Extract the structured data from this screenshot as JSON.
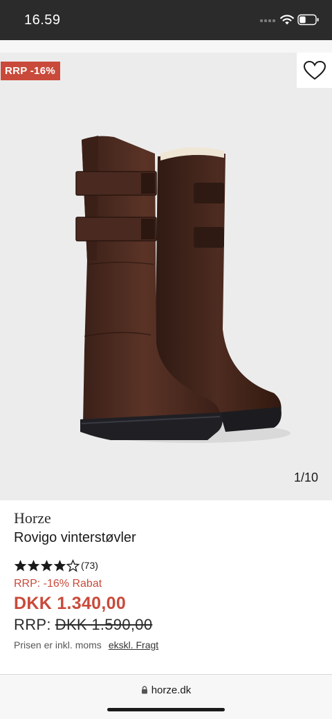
{
  "status_bar": {
    "time": "16.59"
  },
  "product": {
    "badge": "RRP -16%",
    "image_counter": "1/10",
    "brand": "Horze",
    "title": "Rovigo vinterstøvler",
    "rating": {
      "stars": 4,
      "max": 5,
      "count_label": "(73)"
    },
    "discount_label": "RRP: -16% Rabat",
    "price": "DKK 1.340,00",
    "rrp_label": "RRP:",
    "rrp_price": "DKK 1.590,00",
    "vat_note": "Prisen er inkl. moms",
    "shipping_link": "ekskl. Fragt"
  },
  "browser": {
    "url": "horze.dk"
  },
  "colors": {
    "sale_red": "#c94a3a",
    "status_bar": "#2b2b2b",
    "image_bg": "#ececec",
    "boot_brown": "#4a2a20"
  },
  "icons": [
    "wifi-icon",
    "battery-icon",
    "heart-icon",
    "star-icon",
    "lock-icon"
  ]
}
